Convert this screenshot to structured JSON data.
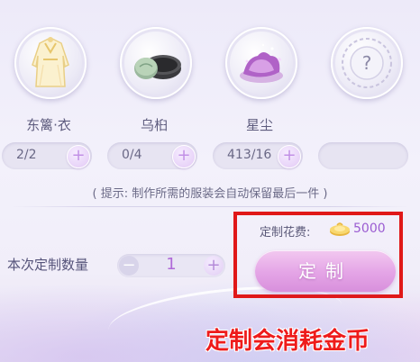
{
  "materials": [
    {
      "name": "东篱·衣",
      "count": "2/2",
      "icon": "robe-icon"
    },
    {
      "name": "乌桕",
      "count": "0/4",
      "icon": "ink-box-icon"
    },
    {
      "name": "星尘",
      "count": "413/16",
      "icon": "stardust-icon"
    },
    {
      "name": "",
      "count": "",
      "icon": "question-mark-icon"
    }
  ],
  "hint": "( 提示: 制作所需的服装会自动保留最后一件 )",
  "quantity": {
    "label": "本次定制数量",
    "value": "1"
  },
  "fee": {
    "label": "定制花费:",
    "value": "5000",
    "currency_icon": "gold-coin-icon"
  },
  "craft_button": {
    "label": "定制"
  },
  "annotation": {
    "text": "定制会消耗金币",
    "color": "#ee1b1b"
  },
  "colors": {
    "accent": "#b06ad8",
    "button": "#e4a4e6",
    "highlight": "#e01818"
  }
}
